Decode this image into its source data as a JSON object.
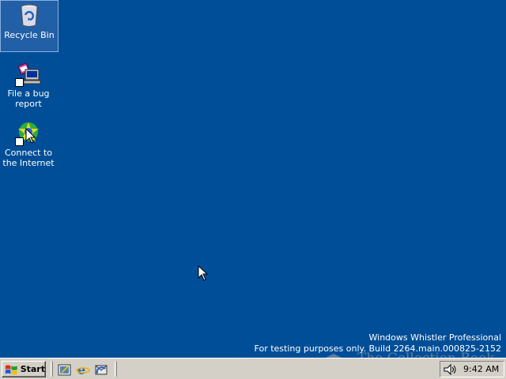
{
  "desktop": {
    "background_color": "#004e98",
    "icons": [
      {
        "label": "Recycle Bin",
        "icon": "recycle-bin-icon",
        "selected": true
      },
      {
        "label": "File a bug report",
        "icon": "bug-report-icon",
        "shortcut": true
      },
      {
        "label": "Connect to the Internet",
        "icon": "connect-internet-icon",
        "shortcut": true
      }
    ],
    "watermark": {
      "line1": "Windows Whistler Professional",
      "line2": "For testing purposes only. Build 2264.main.000825-2152"
    },
    "site_mark": "The Collection Book"
  },
  "taskbar": {
    "start_label": "Start",
    "quick_launch": [
      {
        "icon": "show-desktop-icon"
      },
      {
        "icon": "internet-explorer-icon"
      },
      {
        "icon": "outlook-express-icon"
      }
    ],
    "tray": {
      "volume_icon": "speaker-icon",
      "clock": "9:42 AM"
    }
  }
}
